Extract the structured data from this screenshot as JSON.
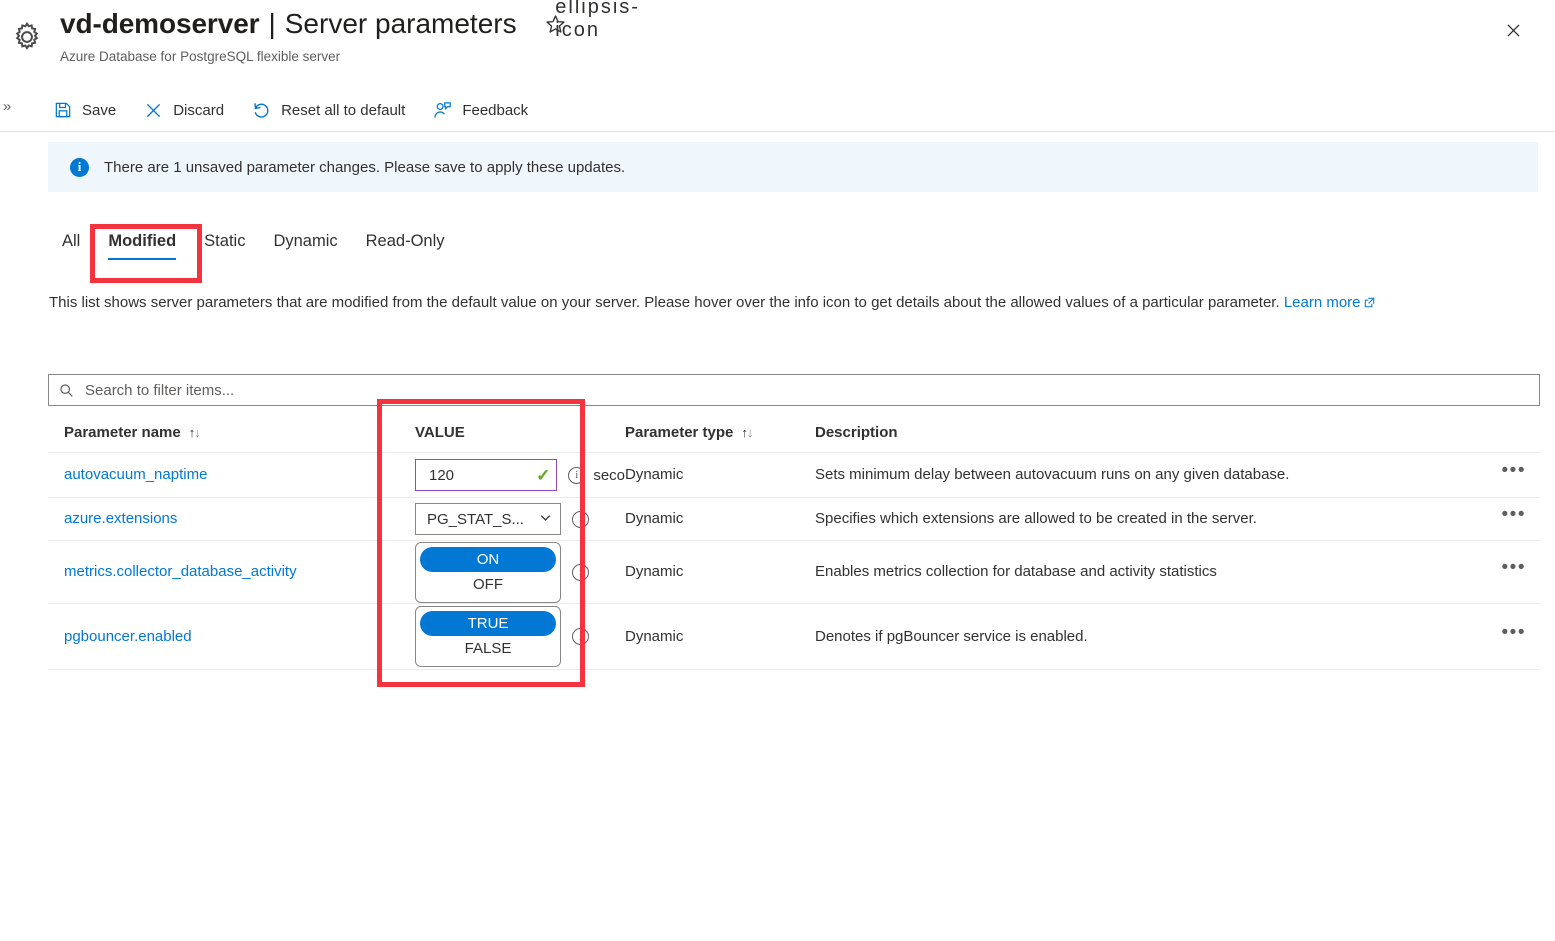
{
  "header": {
    "resource_name": "vd-demoserver",
    "separator": "|",
    "page_name": "Server parameters",
    "subtitle": "Azure Database for PostgreSQL flexible server",
    "favorite_icon": "star-icon",
    "more_icon": "ellipsis-icon",
    "close_icon": "close-icon",
    "resource_icon": "gear-icon",
    "rail_chevron": "»"
  },
  "toolbar": {
    "items": [
      {
        "label": "Save",
        "icon": "save-icon"
      },
      {
        "label": "Discard",
        "icon": "discard-x-icon"
      },
      {
        "label": "Reset all to default",
        "icon": "reset-undo-icon"
      },
      {
        "label": "Feedback",
        "icon": "feedback-person-icon"
      }
    ]
  },
  "notification": {
    "icon": "info-icon",
    "icon_glyph": "i",
    "message": "There are 1 unsaved parameter changes.  Please save to apply these updates.",
    "background_color": "#eff6fc",
    "accent_color": "#0078d4"
  },
  "tabs": {
    "items": [
      {
        "label": "All",
        "active": false
      },
      {
        "label": "Modified",
        "active": true
      },
      {
        "label": "Static",
        "active": false
      },
      {
        "label": "Dynamic",
        "active": false
      },
      {
        "label": "Read-Only",
        "active": false
      }
    ]
  },
  "description": {
    "text": "This list shows server parameters that are modified from the default value on your server. Please hover over the info icon to get details about the allowed values of a particular parameter. ",
    "link_text": "Learn more",
    "link_icon": "external-link-icon"
  },
  "search": {
    "placeholder": "Search to filter items...",
    "value": "",
    "icon": "search-icon"
  },
  "table": {
    "columns": [
      {
        "label": "Parameter name",
        "sortable": true
      },
      {
        "label": "VALUE",
        "sortable": false
      },
      {
        "label": "Parameter type",
        "sortable": true
      },
      {
        "label": "Description",
        "sortable": false
      }
    ],
    "sort_glyph_up": "↑",
    "sort_glyph_down": "↓",
    "row_menu_icon": "ellipsis-icon",
    "row_menu_glyph": "•••",
    "rows": [
      {
        "name": "autovacuum_naptime",
        "control": "number",
        "value": "120",
        "validated": true,
        "validated_glyph": "✓",
        "unit": "seco",
        "info_icon": "info-circle-icon",
        "type": "Dynamic",
        "description": "Sets minimum delay between autovacuum runs on any given database."
      },
      {
        "name": "azure.extensions",
        "control": "select",
        "value": "PG_STAT_S...",
        "chevron": "⌄",
        "info_icon": "info-circle-icon",
        "type": "Dynamic",
        "description": "Specifies which extensions are allowed to be created in the server."
      },
      {
        "name": "metrics.collector_database_activity",
        "control": "toggle",
        "option_on": "ON",
        "option_off": "OFF",
        "selected": "ON",
        "info_icon": "info-circle-icon",
        "type": "Dynamic",
        "description": "Enables metrics collection for database and activity statistics"
      },
      {
        "name": "pgbouncer.enabled",
        "control": "toggle",
        "option_on": "TRUE",
        "option_off": "FALSE",
        "selected": "TRUE",
        "info_icon": "info-circle-icon",
        "type": "Dynamic",
        "description": "Denotes if pgBouncer service is enabled."
      }
    ]
  },
  "annotations": {
    "color": "#f5333f",
    "boxes": [
      {
        "target": "Modified tab"
      },
      {
        "target": "VALUE column"
      }
    ]
  }
}
